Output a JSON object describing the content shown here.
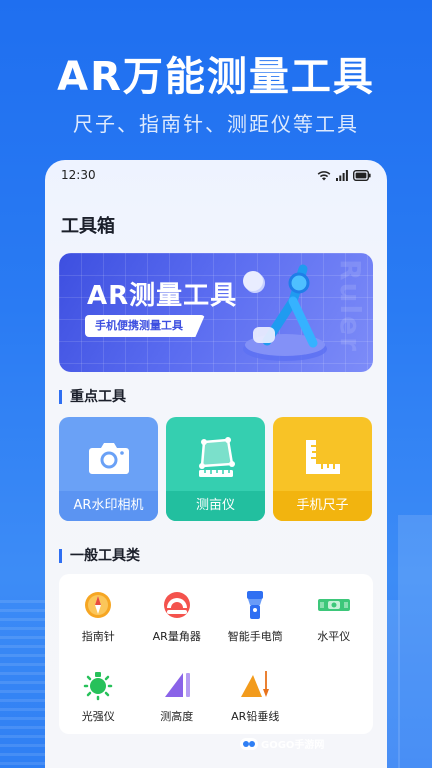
{
  "hero": {
    "title": "AR万能测量工具",
    "subtitle": "尺子、指南针、测距仪等工具"
  },
  "status_bar": {
    "time": "12:30",
    "icons": [
      "wifi-icon",
      "signal-icon",
      "battery-icon"
    ]
  },
  "page_title": "工具箱",
  "banner": {
    "title": "AR测量工具",
    "tag": "手机便携测量工具",
    "watermark": "Ruler"
  },
  "key_tools": {
    "section_title": "重点工具",
    "items": [
      {
        "label": "AR水印相机",
        "icon": "camera-icon",
        "color": "#6aa1f6"
      },
      {
        "label": "测亩仪",
        "icon": "area-measure-icon",
        "color": "#35cfb0"
      },
      {
        "label": "手机尺子",
        "icon": "ruler-icon",
        "color": "#f8c326"
      }
    ]
  },
  "general_tools": {
    "section_title": "一般工具类",
    "items": [
      {
        "label": "指南针",
        "icon": "compass-icon"
      },
      {
        "label": "AR量角器",
        "icon": "protractor-icon"
      },
      {
        "label": "智能手电筒",
        "icon": "flashlight-icon"
      },
      {
        "label": "水平仪",
        "icon": "level-icon"
      },
      {
        "label": "光强仪",
        "icon": "light-meter-icon"
      },
      {
        "label": "测高度",
        "icon": "height-measure-icon"
      },
      {
        "label": "AR铅垂线",
        "icon": "plumb-line-icon"
      }
    ]
  },
  "watermark_brand": "GOGO手游网"
}
